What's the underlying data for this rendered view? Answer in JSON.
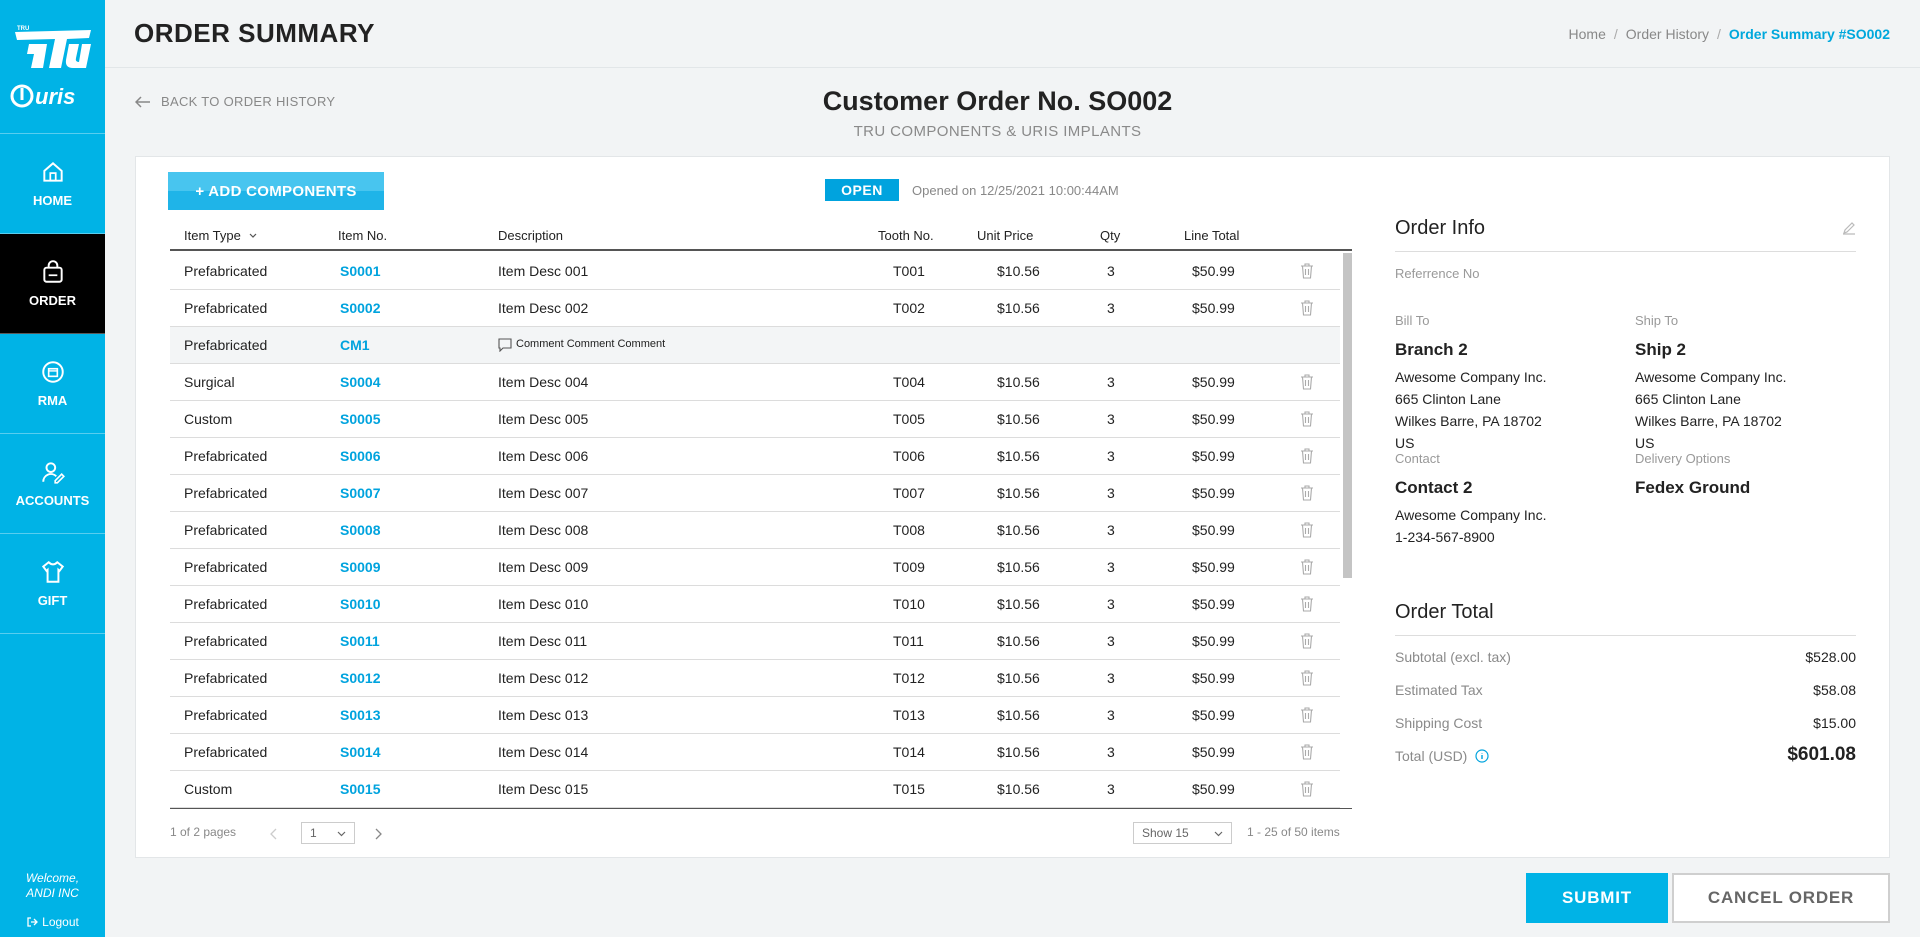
{
  "sidebar": {
    "logo_text": "TRU",
    "brand_text": "uris",
    "items": [
      {
        "label": "HOME",
        "icon": "home-icon"
      },
      {
        "label": "ORDER",
        "icon": "shopping-bag-icon",
        "active": true
      },
      {
        "label": "RMA",
        "icon": "return-box-icon"
      },
      {
        "label": "ACCOUNTS",
        "icon": "user-edit-icon"
      },
      {
        "label": "GIFT",
        "icon": "shirt-icon"
      }
    ],
    "welcome_line1": "Welcome,",
    "welcome_line2": "ANDI INC",
    "logout": "Logout"
  },
  "header": {
    "title": "ORDER SUMMARY",
    "breadcrumb": [
      "Home",
      "Order History",
      "Order Summary #SO002"
    ],
    "separator": "/"
  },
  "back_link": "BACK TO ORDER HISTORY",
  "order": {
    "title": "Customer Order No. SO002",
    "subtitle": "TRU COMPONENTS & URIS IMPLANTS",
    "status": "OPEN",
    "opened": "Opened on 12/25/2021 10:00:44AM",
    "add_button": "+ ADD COMPONENTS"
  },
  "table": {
    "headers": {
      "type": "Item Type",
      "item": "Item No.",
      "desc": "Description",
      "tooth": "Tooth No.",
      "price": "Unit Price",
      "qty": "Qty",
      "total": "Line Total"
    },
    "rows": [
      {
        "type": "Prefabricated",
        "item": "S0001",
        "desc": "Item Desc 001",
        "tooth": "T001",
        "price": "$10.56",
        "qty": "3",
        "total": "$50.99"
      },
      {
        "type": "Prefabricated",
        "item": "S0002",
        "desc": "Item Desc 002",
        "tooth": "T002",
        "price": "$10.56",
        "qty": "3",
        "total": "$50.99"
      },
      {
        "type": "Prefabricated",
        "item": "CM1",
        "desc": "Comment Comment Comment",
        "tooth": "",
        "price": "",
        "qty": "",
        "total": "",
        "comment": true
      },
      {
        "type": "Surgical",
        "item": "S0004",
        "desc": "Item Desc 004",
        "tooth": "T004",
        "price": "$10.56",
        "qty": "3",
        "total": "$50.99"
      },
      {
        "type": "Custom",
        "item": "S0005",
        "desc": "Item Desc 005",
        "tooth": "T005",
        "price": "$10.56",
        "qty": "3",
        "total": "$50.99"
      },
      {
        "type": "Prefabricated",
        "item": "S0006",
        "desc": "Item Desc 006",
        "tooth": "T006",
        "price": "$10.56",
        "qty": "3",
        "total": "$50.99"
      },
      {
        "type": "Prefabricated",
        "item": "S0007",
        "desc": "Item Desc 007",
        "tooth": "T007",
        "price": "$10.56",
        "qty": "3",
        "total": "$50.99"
      },
      {
        "type": "Prefabricated",
        "item": "S0008",
        "desc": "Item Desc 008",
        "tooth": "T008",
        "price": "$10.56",
        "qty": "3",
        "total": "$50.99"
      },
      {
        "type": "Prefabricated",
        "item": "S0009",
        "desc": "Item Desc 009",
        "tooth": "T009",
        "price": "$10.56",
        "qty": "3",
        "total": "$50.99"
      },
      {
        "type": "Prefabricated",
        "item": "S0010",
        "desc": "Item Desc 010",
        "tooth": "T010",
        "price": "$10.56",
        "qty": "3",
        "total": "$50.99"
      },
      {
        "type": "Prefabricated",
        "item": "S0011",
        "desc": "Item Desc 011",
        "tooth": "T011",
        "price": "$10.56",
        "qty": "3",
        "total": "$50.99"
      },
      {
        "type": "Prefabricated",
        "item": "S0012",
        "desc": "Item Desc 012",
        "tooth": "T012",
        "price": "$10.56",
        "qty": "3",
        "total": "$50.99"
      },
      {
        "type": "Prefabricated",
        "item": "S0013",
        "desc": "Item Desc 013",
        "tooth": "T013",
        "price": "$10.56",
        "qty": "3",
        "total": "$50.99"
      },
      {
        "type": "Prefabricated",
        "item": "S0014",
        "desc": "Item Desc 014",
        "tooth": "T014",
        "price": "$10.56",
        "qty": "3",
        "total": "$50.99"
      },
      {
        "type": "Custom",
        "item": "S0015",
        "desc": "Item Desc 015",
        "tooth": "T015",
        "price": "$10.56",
        "qty": "3",
        "total": "$50.99"
      }
    ]
  },
  "pagination": {
    "pages": "1 of 2 pages",
    "current_page": "1",
    "show": "Show 15",
    "range": "1 - 25 of 50 items"
  },
  "order_info": {
    "title": "Order Info",
    "reference_label": "Referrence No",
    "bill_to_label": "Bill To",
    "bill_to_name": "Branch 2",
    "bill_to_address": [
      "Awesome Company Inc.",
      "665 Clinton Lane",
      "Wilkes Barre, PA 18702",
      "US"
    ],
    "ship_to_label": "Ship To",
    "ship_to_name": "Ship 2",
    "ship_to_address": [
      "Awesome Company Inc.",
      "665 Clinton Lane",
      "Wilkes Barre, PA 18702",
      "US"
    ],
    "contact_label": "Contact",
    "contact_name": "Contact 2",
    "contact_lines": [
      "Awesome Company Inc.",
      "1-234-567-8900"
    ],
    "delivery_label": "Delivery Options",
    "delivery_value": "Fedex Ground"
  },
  "order_total": {
    "title": "Order Total",
    "subtotal_label": "Subtotal (excl. tax)",
    "subtotal": "$528.00",
    "tax_label": "Estimated Tax",
    "tax": "$58.08",
    "shipping_label": "Shipping Cost",
    "shipping": "$15.00",
    "total_label": "Total (USD)",
    "total": "$601.08"
  },
  "actions": {
    "submit": "SUBMIT",
    "cancel": "CANCEL ORDER"
  },
  "colors": {
    "accent": "#00b3e6",
    "link": "#00a3de",
    "active_nav": "#000000"
  }
}
